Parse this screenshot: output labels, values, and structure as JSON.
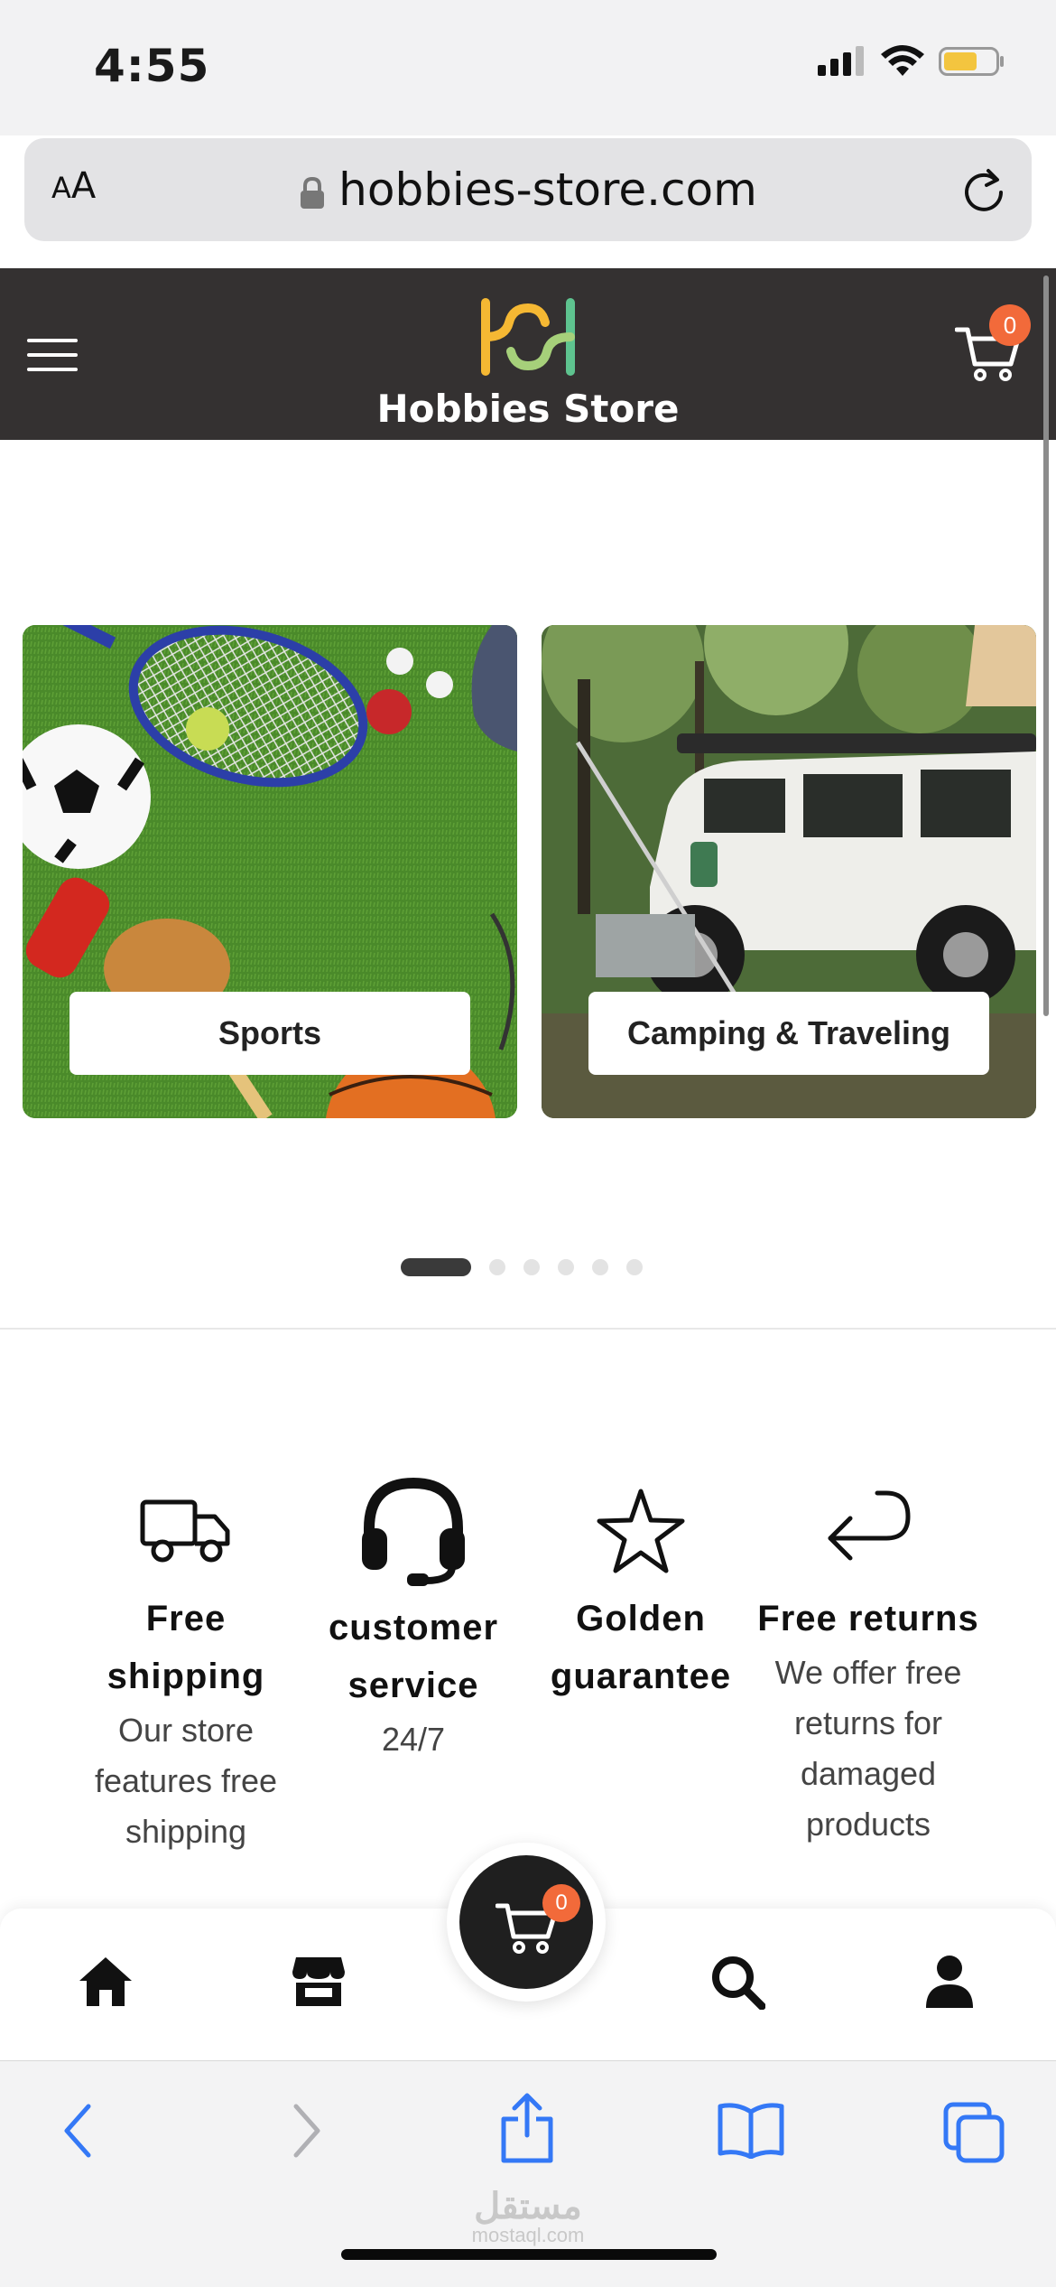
{
  "status_bar": {
    "time": "4:55"
  },
  "browser": {
    "text_size_button": "AA",
    "url": "hobbies-store.com"
  },
  "header": {
    "logo_text": "Hobbies Store",
    "cart_count": "0"
  },
  "categories": [
    {
      "label": "Sports"
    },
    {
      "label": "Camping & Traveling"
    }
  ],
  "carousel": {
    "total_dots": 6,
    "active_index": 0
  },
  "features": [
    {
      "title": "Free shipping",
      "description": "Our store features free shipping"
    },
    {
      "title": "customer service",
      "description": "24/7"
    },
    {
      "title": "Golden guarantee",
      "description": ""
    },
    {
      "title": "Free returns",
      "description": "We offer free returns for damaged products"
    }
  ],
  "bottom_nav": {
    "items": [
      "home-icon",
      "store-icon",
      "cart-icon",
      "search-icon",
      "user-icon"
    ],
    "cart_count": "0"
  },
  "safari_toolbar": {
    "items": [
      "back-icon",
      "forward-icon",
      "share-icon",
      "bookmarks-icon",
      "tabs-icon"
    ]
  },
  "watermark": {
    "text": "مستقل",
    "subtext": "mostaql.com"
  },
  "colors": {
    "header_bg": "#343131",
    "badge": "#f26a3a",
    "link_blue": "#3478f6"
  }
}
